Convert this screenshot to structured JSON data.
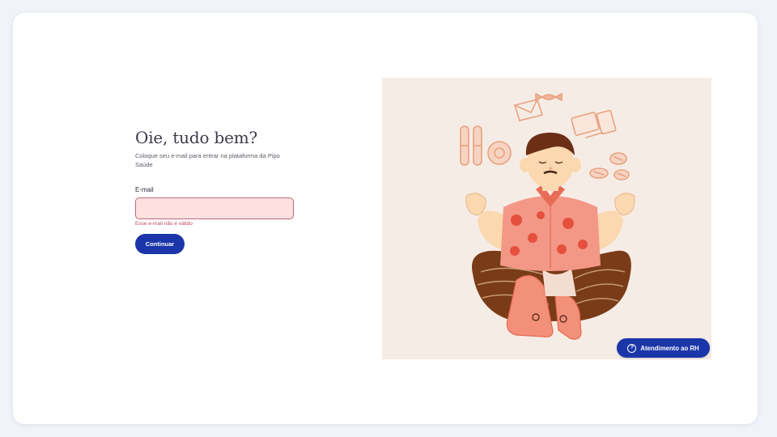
{
  "login": {
    "title": "Oie, tudo bem?",
    "subtitle": "Coloque seu e-mail para entrar na plataforma da Pipo Saúde",
    "email_label": "E-mail",
    "email_value": "",
    "email_error": "Esse e-mail não é válido",
    "submit_label": "Continuar"
  },
  "help_button": {
    "label": "Atendimento ao RH",
    "icon": "question-circle-icon"
  },
  "colors": {
    "primary": "#1a36a8",
    "error": "#c24a5a",
    "input_error_bg": "#fde0e0",
    "illustration_bg": "#f6ece6"
  }
}
